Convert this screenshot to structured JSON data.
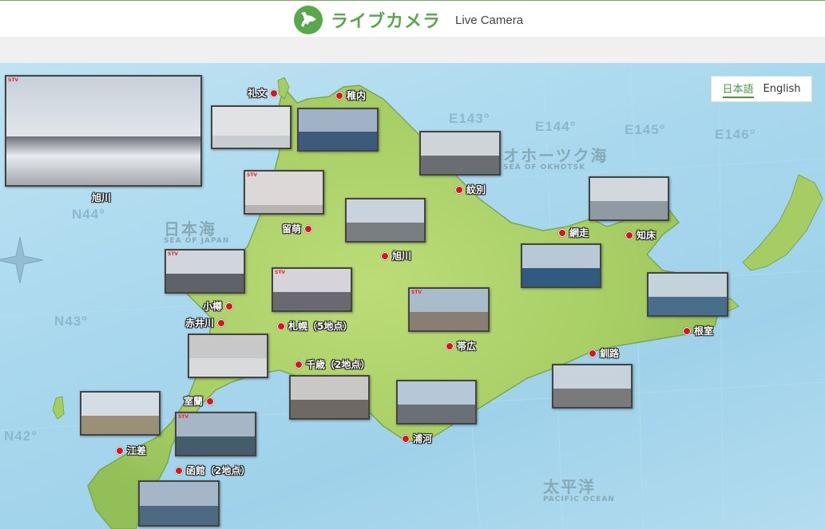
{
  "header": {
    "title": "ライブカメラ",
    "subtitle": "Live Camera",
    "logo_icon": "hokkaido-icon"
  },
  "language": {
    "japanese": "日本語",
    "english": "English",
    "selected": "日本語"
  },
  "map_labels": {
    "coords": [
      "E143°",
      "E144°",
      "E145°",
      "E146°",
      "N44°",
      "N43°",
      "N42°"
    ],
    "seas": {
      "okhotsk": "オホーツク海",
      "okhotsk_en": "SEA OF OKHOTSK",
      "japan": "日本海",
      "japan_en": "SEA OF JAPAN",
      "pacific": "太平洋",
      "pacific_en": "PACIFIC OCEAN"
    }
  },
  "featured": {
    "label": "旭川"
  },
  "locations": [
    {
      "id": "rebun",
      "label": "礼文"
    },
    {
      "id": "wakkanai",
      "label": "稚内"
    },
    {
      "id": "monbetsu",
      "label": "紋別"
    },
    {
      "id": "rumoi",
      "label": "留萌"
    },
    {
      "id": "asahikawa",
      "label": "旭川"
    },
    {
      "id": "abashiri",
      "label": "網走"
    },
    {
      "id": "shiretoko",
      "label": "知床"
    },
    {
      "id": "otaru",
      "label": "小樽"
    },
    {
      "id": "akaigawa",
      "label": "赤井川"
    },
    {
      "id": "sapporo",
      "label": "札幌（5地点）"
    },
    {
      "id": "obihiro",
      "label": "帯広"
    },
    {
      "id": "nemuro",
      "label": "根室"
    },
    {
      "id": "kushiro",
      "label": "釧路"
    },
    {
      "id": "chitose",
      "label": "千歳（2地点）"
    },
    {
      "id": "muroran",
      "label": "室蘭"
    },
    {
      "id": "esashi",
      "label": "江差"
    },
    {
      "id": "urakawa",
      "label": "浦河"
    },
    {
      "id": "hakodate",
      "label": "函館（2地点）"
    }
  ],
  "colors": {
    "accent": "#5aa84c",
    "pin": "#d8151b",
    "sea": "#a9d8ee",
    "land": "#a9cf6a"
  }
}
